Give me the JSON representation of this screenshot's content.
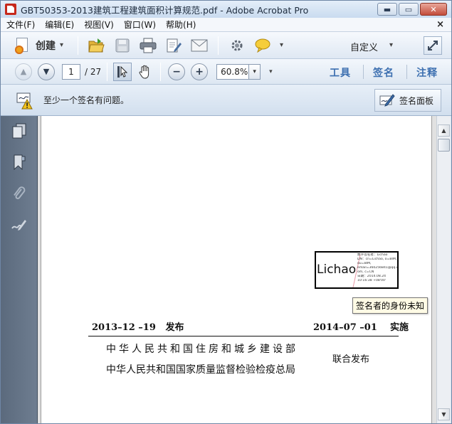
{
  "window": {
    "title": "GBT50353-2013建筑工程建筑面积计算规范.pdf - Adobe Acrobat Pro",
    "minimize_glyph": "▬",
    "maximize_glyph": "▭",
    "close_glyph": "✕"
  },
  "menu": {
    "items": [
      "文件(F)",
      "编辑(E)",
      "视图(V)",
      "窗口(W)",
      "帮助(H)"
    ],
    "close_glyph": "×"
  },
  "toolbar": {
    "create_label": "创建",
    "customize_label": "自定义",
    "caret": "▾"
  },
  "nav": {
    "current_page": "1",
    "total_pages": "/ 27",
    "zoom": "60.8%",
    "dropdown_glyph": "▾"
  },
  "panes": {
    "tools": "工具",
    "sign": "签名",
    "comment": "注释"
  },
  "signature_bar": {
    "message": "至少一个签名有问题。",
    "panel_label": "签名面板"
  },
  "document": {
    "signature": {
      "name": "Lichao",
      "details": [
        "数字签名者：Lichao",
        "DN：cn=Lichao, o=BIM,",
        "ou=BIM,",
        "email=360256841@qq.c",
        "om, c=CN",
        "日期：2014.08.24",
        "10:16:38 +08'00'"
      ]
    },
    "tooltip": "签名者的身份未知",
    "issued_date": "2013–12 –19",
    "issued_label": "发布",
    "effective_date": "2014–07 –01",
    "effective_label": "实施",
    "org1": "中华人民共和国住房和城乡建设部",
    "org2": "中华人民共和国国家质量监督检验检疫总局",
    "joint_label": "联合发布"
  },
  "colors": {
    "accent_blue": "#3c6fb0",
    "warning_yellow": "#f2c21b",
    "close_red": "#c24b3a"
  }
}
